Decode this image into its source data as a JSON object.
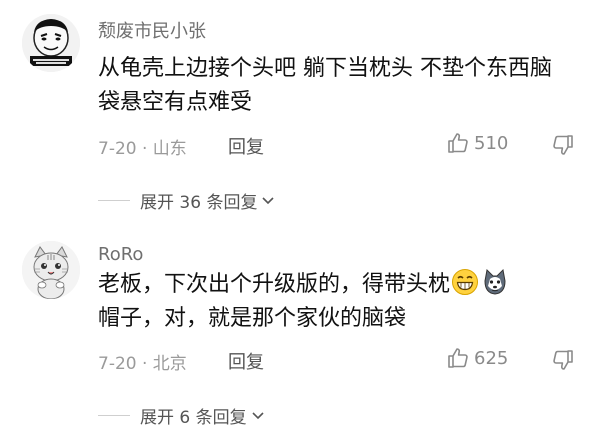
{
  "comments": [
    {
      "username": "颓废市民小张",
      "text": "从龟壳上边接个头吧  躺下当枕头  不垫个东西脑袋悬空有点难受",
      "date_location": "7-20 · 山东",
      "reply_label": "回复",
      "likes": "510",
      "expand_label": "展开 36 条回复"
    },
    {
      "username": "RoRo",
      "text_before": "老板，下次出个升级版的，得带头枕",
      "text_after": "帽子，对，就是那个家伙的脑袋",
      "date_location": "7-20 · 北京",
      "reply_label": "回复",
      "likes": "625",
      "expand_label": "展开 6 条回复"
    }
  ],
  "icons": {
    "like": "thumbs-up-icon",
    "dislike": "thumbs-down-icon",
    "expand": "chevron-down-icon",
    "emoji1": "grin-emoji",
    "emoji2": "husky-emoji"
  },
  "colors": {
    "username": "#6f6f6f",
    "meta": "#9a9a9a",
    "text": "#111111"
  }
}
